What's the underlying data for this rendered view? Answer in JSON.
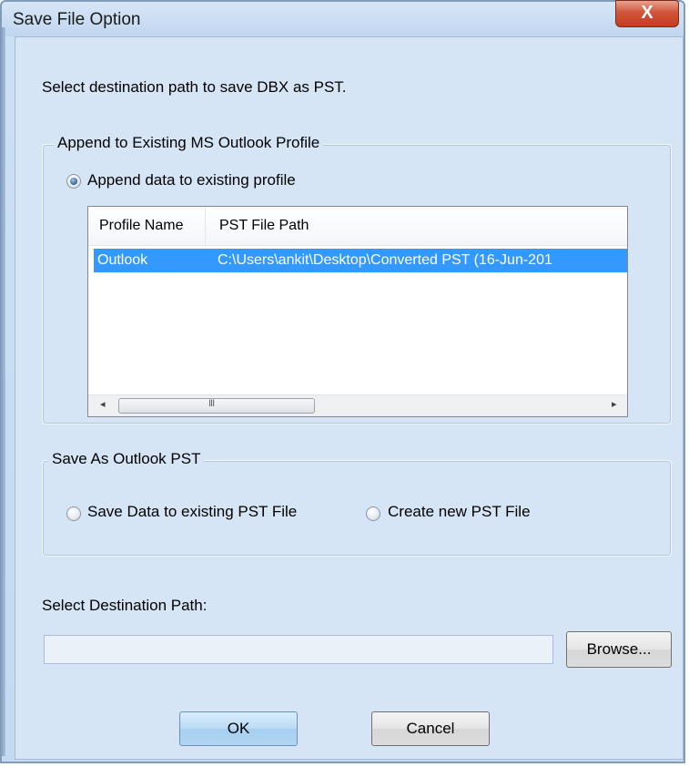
{
  "window": {
    "title": "Save File Option",
    "close_glyph": "X"
  },
  "instruction": "Select destination path to save DBX as PST.",
  "append_group": {
    "legend": "Append to Existing MS Outlook Profile",
    "option": {
      "label": "Append data to existing profile",
      "checked": true
    }
  },
  "profiles": {
    "columns": [
      "Profile Name",
      "PST File Path"
    ],
    "rows": [
      {
        "name": "Outlook",
        "path": "C:\\Users\\ankit\\Desktop\\Converted PST (16-Jun-201",
        "selected": true
      }
    ],
    "scroll": {
      "left_arrow": "◂",
      "right_arrow": "▸",
      "grip": "III"
    }
  },
  "save_group": {
    "legend": "Save As Outlook PST",
    "options": [
      {
        "label": "Save Data to existing PST File",
        "checked": false
      },
      {
        "label": "Create new PST File",
        "checked": false
      }
    ]
  },
  "destination": {
    "label": "Select Destination Path:",
    "value": "",
    "browse_label": "Browse..."
  },
  "buttons": {
    "ok": "OK",
    "cancel": "Cancel"
  },
  "colors": {
    "selection": "#3399ff",
    "close_button": "#c43d21",
    "dialog_bg": "#d6e5f6"
  }
}
